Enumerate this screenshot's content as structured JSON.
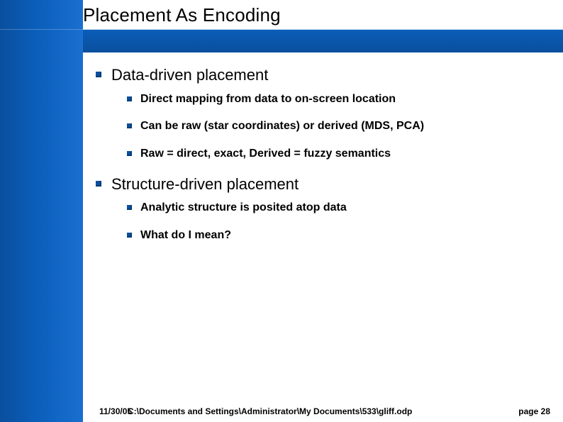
{
  "title": "Placement As Encoding",
  "sections": [
    {
      "heading": "Data-driven placement",
      "items": [
        "Direct mapping from data to on-screen location",
        "Can be raw (star coordinates) or derived (MDS, PCA)",
        "Raw = direct, exact, Derived = fuzzy semantics"
      ]
    },
    {
      "heading": "Structure-driven placement",
      "items": [
        "Analytic structure is posited atop data",
        "What do I mean?"
      ]
    }
  ],
  "footer": {
    "date": "11/30/05",
    "path": "C:\\Documents and Settings\\Administrator\\My Documents\\533\\gliff.odp",
    "page_label": "page 28"
  }
}
